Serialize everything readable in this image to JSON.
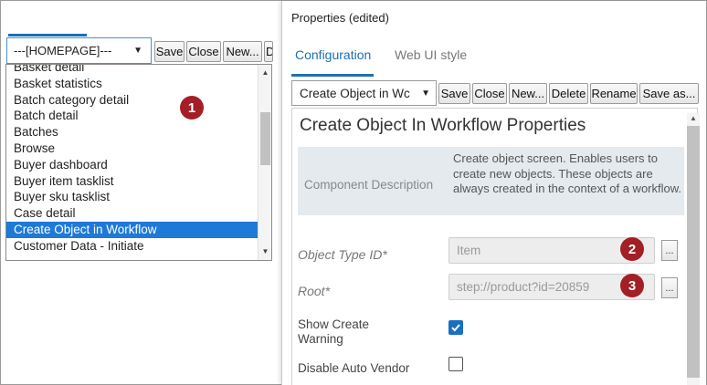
{
  "left": {
    "page_select": {
      "value": "---[HOMEPAGE]---"
    },
    "toolbar": {
      "save": "Save",
      "close": "Close",
      "new": "New...",
      "cut": "D"
    },
    "list_items": [
      "Basket detail",
      "Basket statistics",
      "Batch category detail",
      "Batch detail",
      "Batches",
      "Browse",
      "Buyer dashboard",
      "Buyer item tasklist",
      "Buyer sku tasklist",
      "Case detail",
      "Create Object in Workflow",
      "Customer Data - Initiate"
    ],
    "selected_item": "Create Object in Workflow",
    "callout": "1"
  },
  "panel": {
    "title": "Properties (edited)",
    "tabs": [
      {
        "label": "Configuration",
        "active": true
      },
      {
        "label": "Web UI style",
        "active": false
      }
    ],
    "component_select": {
      "value": "Create Object in Wc"
    },
    "toolbar": {
      "save": "Save",
      "close": "Close",
      "new": "New...",
      "delete": "Delete",
      "rename": "Rename",
      "save_as": "Save as..."
    },
    "content": {
      "heading": "Create Object In Workflow Properties",
      "description_label": "Component Description",
      "description_text": "Create object screen. Enables users to create new objects. These objects are always created in the context of a workflow.",
      "fields": [
        {
          "label": "Object Type ID*",
          "value": "Item",
          "button": "...",
          "callout": "2"
        },
        {
          "label": "Root*",
          "value": "step://product?id=20859",
          "button": "...",
          "callout": "3"
        }
      ],
      "checks": [
        {
          "label": "Show Create Warning",
          "checked": true
        },
        {
          "label": "Disable Auto Vendor",
          "checked": false
        }
      ]
    }
  },
  "colors": {
    "accent": "#1f6fb2",
    "selection": "#1e79d7",
    "callout": "#a31f26"
  }
}
